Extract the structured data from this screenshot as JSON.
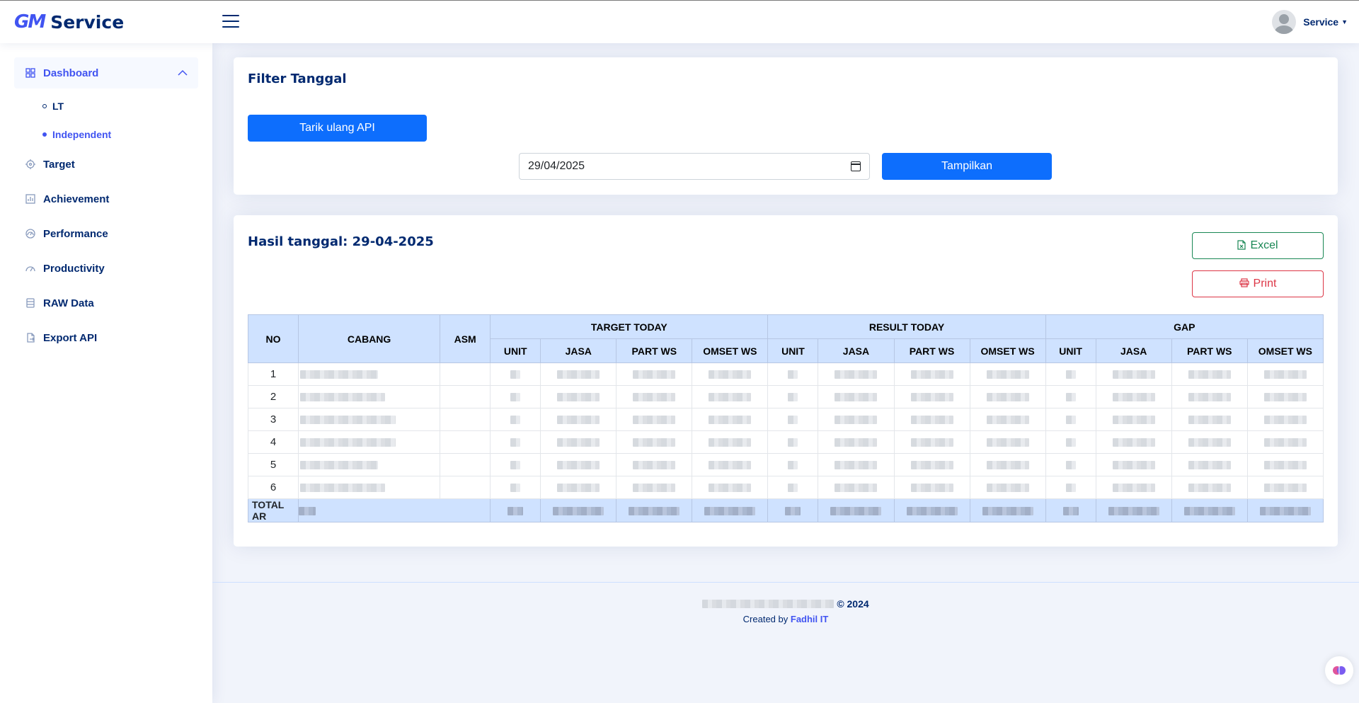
{
  "header": {
    "logo_mark": "GM",
    "logo_text": "Service",
    "profile_name": "Service"
  },
  "sidebar": {
    "items": [
      {
        "label": "Dashboard",
        "icon": "grid-icon",
        "active": true
      },
      {
        "label": "Target",
        "icon": "target-icon"
      },
      {
        "label": "Achievement",
        "icon": "bar-chart-icon"
      },
      {
        "label": "Performance",
        "icon": "gauge-icon"
      },
      {
        "label": "Productivity",
        "icon": "speedometer-icon"
      },
      {
        "label": "RAW Data",
        "icon": "database-icon"
      },
      {
        "label": "Export API",
        "icon": "file-export-icon"
      }
    ],
    "sub_items": [
      {
        "label": "LT"
      },
      {
        "label": "Independent",
        "active": true
      }
    ]
  },
  "filter": {
    "title": "Filter Tanggal",
    "reload_button": "Tarik ulang API",
    "date_value": "29/04/2025",
    "show_button": "Tampilkan"
  },
  "results": {
    "title": "Hasil tanggal: 29-04-2025",
    "excel_button": "Excel",
    "print_button": "Print",
    "table": {
      "col_no": "NO",
      "col_cabang": "CABANG",
      "col_asm": "ASM",
      "groups": [
        "TARGET TODAY",
        "RESULT TODAY",
        "GAP"
      ],
      "sub_cols": [
        "UNIT",
        "JASA",
        "PART WS",
        "OMSET WS"
      ],
      "row_numbers": [
        "1",
        "2",
        "3",
        "4",
        "5",
        "6"
      ],
      "total_label": "TOTAL AR"
    }
  },
  "footer": {
    "copyright_suffix": "© 2024",
    "created_by": "Created by",
    "author": "Fadhil IT"
  }
}
